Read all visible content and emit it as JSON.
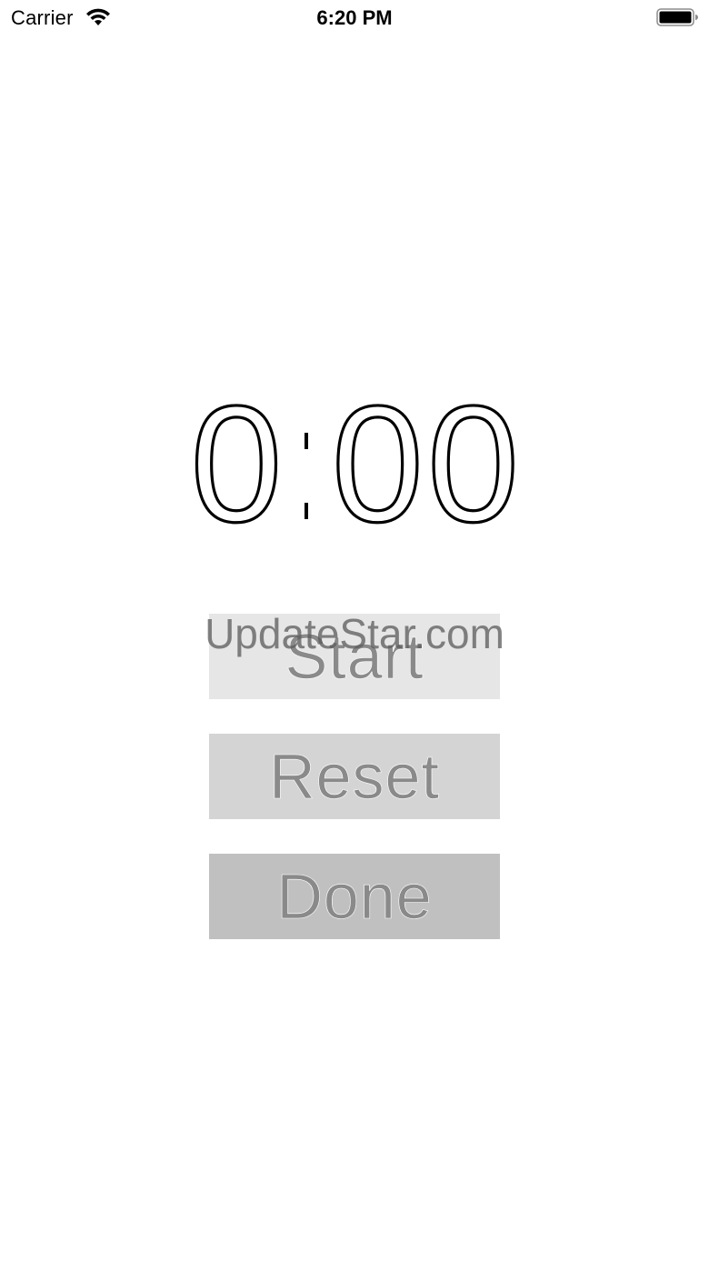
{
  "status_bar": {
    "carrier": "Carrier",
    "time": "6:20 PM",
    "icons": [
      "wifi-icon",
      "battery-icon"
    ]
  },
  "timer": {
    "minutes": "0",
    "seconds": "00"
  },
  "buttons": {
    "start_label": "Start",
    "reset_label": "Reset",
    "done_label": "Done"
  },
  "watermark": "UpdateStar.com",
  "colors": {
    "background": "#ffffff",
    "start_bg": "#e6e6e6",
    "reset_bg": "#d4d4d4",
    "done_bg": "#c0c0c0",
    "button_text": "#7a7a7a"
  }
}
